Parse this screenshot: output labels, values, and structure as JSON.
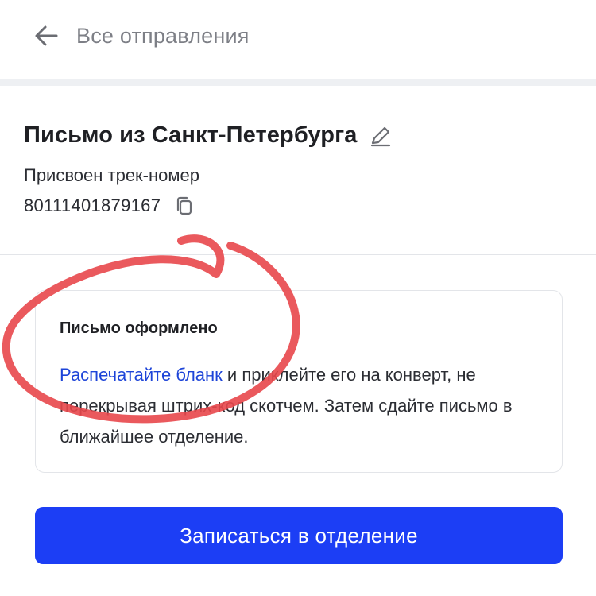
{
  "nav": {
    "back_label": "Все отправления",
    "back_icon": "arrow-left-icon"
  },
  "shipment": {
    "title": "Письмо из Санкт-Петербурга",
    "edit_icon": "pencil-icon",
    "track_label": "Присвоен трек-номер",
    "track_number": "80111401879167",
    "copy_icon": "copy-icon"
  },
  "info_card": {
    "title": "Письмо оформлено",
    "link_text": "Распечатайте бланк",
    "text_after_link": " и приклейте его на конверт, не перекрывая штрих-код скотчем. Затем сдайте письмо в ближайшее отделение."
  },
  "actions": {
    "primary_label": "Записаться в отделение"
  },
  "colors": {
    "accent": "#1c3ef5",
    "link": "#1d44d8",
    "annotation": "#e8474b"
  }
}
